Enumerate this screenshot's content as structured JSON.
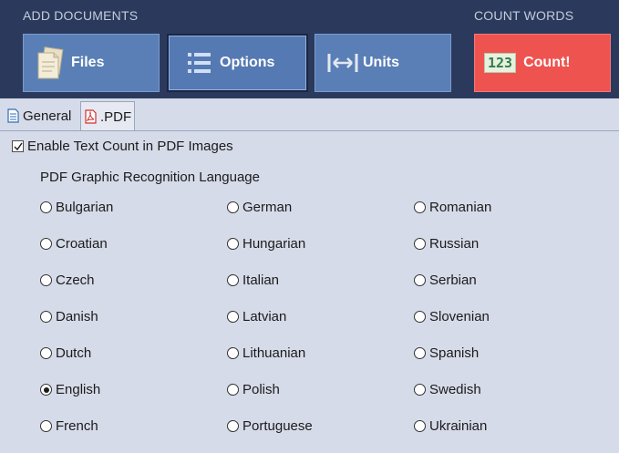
{
  "toolbar": {
    "add_documents_label": "ADD DOCUMENTS",
    "count_words_label": "COUNT WORDS",
    "files_label": "Files",
    "options_label": "Options",
    "units_label": "Units",
    "count_label": "Count!",
    "count_icon_text": "123"
  },
  "tabs": {
    "general": "General",
    "pdf": ".PDF"
  },
  "options": {
    "enable_text_count": "Enable Text Count in PDF Images",
    "enable_checked": true,
    "group_title": "PDF Graphic Recognition Language",
    "selected_language": "English",
    "col1": [
      "Bulgarian",
      "Croatian",
      "Czech",
      "Danish",
      "Dutch",
      "English",
      "French"
    ],
    "col2": [
      "German",
      "Hungarian",
      "Italian",
      "Latvian",
      "Lithuanian",
      "Polish",
      "Portuguese"
    ],
    "col3": [
      "Romanian",
      "Russian",
      "Serbian",
      "Slovenian",
      "Spanish",
      "Swedish",
      "Ukrainian"
    ]
  },
  "colors": {
    "toolbar_bg": "#2b3a5c",
    "button_blue": "#5a7fb6",
    "count_red": "#ef5350",
    "panel_bg": "#d6dbe9"
  },
  "icons": {
    "files": "document-stack-icon",
    "options": "list-icon",
    "units": "resize-arrows-icon",
    "count": "counter-123-icon",
    "general_tab": "document-icon",
    "pdf_tab": "pdf-icon",
    "checkbox": "checkmark-icon"
  }
}
